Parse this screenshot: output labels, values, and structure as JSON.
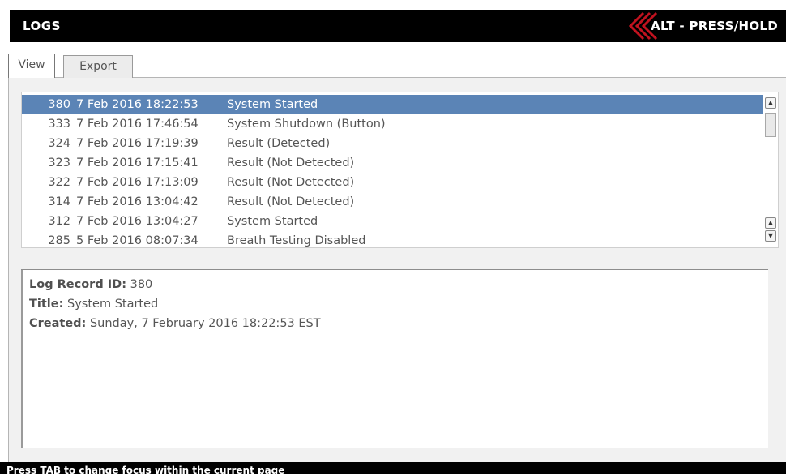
{
  "header": {
    "title": "LOGS",
    "alt_label": "ALT - PRESS/HOLD",
    "accent_color": "#c1121f"
  },
  "tabs": [
    {
      "label": "View",
      "active": true
    },
    {
      "label": "Export",
      "active": false
    }
  ],
  "log_list": {
    "selected_index": 0,
    "rows": [
      {
        "id": "380",
        "date": "7 Feb 2016 18:22:53",
        "event": "System Started"
      },
      {
        "id": "333",
        "date": "7 Feb 2016 17:46:54",
        "event": "System Shutdown (Button)"
      },
      {
        "id": "324",
        "date": "7 Feb 2016 17:19:39",
        "event": "Result (Detected)"
      },
      {
        "id": "323",
        "date": "7 Feb 2016 17:15:41",
        "event": "Result (Not Detected)"
      },
      {
        "id": "322",
        "date": "7 Feb 2016 17:13:09",
        "event": "Result (Not Detected)"
      },
      {
        "id": "314",
        "date": "7 Feb 2016 13:04:42",
        "event": "Result (Not Detected)"
      },
      {
        "id": "312",
        "date": "7 Feb 2016 13:04:27",
        "event": "System Started"
      },
      {
        "id": "285",
        "date": "5 Feb 2016 08:07:34",
        "event": "Breath Testing Disabled"
      }
    ],
    "selection_color": "#5b84b6"
  },
  "detail": {
    "record_id_label": "Log Record ID:",
    "record_id_value": " 380",
    "title_label": "Title:",
    "title_value": " System Started",
    "created_label": "Created:",
    "created_value": " Sunday, 7 February 2016 18:22:53 EST"
  },
  "status": {
    "message": "Press TAB to change focus within the current page"
  }
}
